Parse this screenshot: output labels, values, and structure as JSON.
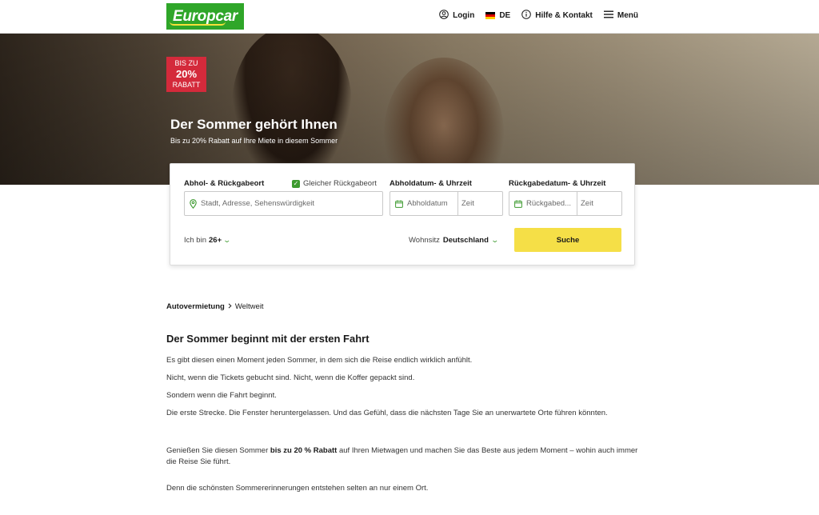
{
  "header": {
    "logo_text": "Europcar",
    "nav": {
      "login": "Login",
      "language": "DE",
      "help": "Hilfe & Kontakt",
      "menu": "Menü"
    }
  },
  "hero": {
    "badge_line1": "BIS ZU",
    "badge_line2": "20%",
    "badge_line3": "RABATT",
    "title": "Der Sommer gehört Ihnen",
    "subtitle": "Bis zu 20% Rabatt auf Ihre Miete in diesem Sommer"
  },
  "booking": {
    "location_label": "Abhol- & Rückgabeort",
    "same_return_label": "Gleicher Rückgabeort",
    "same_return_checked": true,
    "pickup_label": "Abholdatum- & Uhrzeit",
    "return_label": "Rückgabedatum- & Uhrzeit",
    "location_placeholder": "Stadt, Adresse, Sehenswürdigkeit",
    "pickup_date_placeholder": "Abholdatum",
    "pickup_time_placeholder": "Zeit",
    "return_date_placeholder": "Rückgabed...",
    "return_time_placeholder": "Zeit",
    "age_prefix": "Ich bin",
    "age_value": "26+",
    "residence_label": "Wohnsitz",
    "residence_value": "Deutschland",
    "search_button": "Suche"
  },
  "breadcrumb": {
    "item1": "Autovermietung",
    "item2": "Weltweit"
  },
  "content": {
    "title": "Der Sommer beginnt mit der ersten Fahrt",
    "p1": "Es gibt diesen einen Moment jeden Sommer, in dem sich die Reise endlich wirklich anfühlt.",
    "p2": "Nicht, wenn die Tickets gebucht sind. Nicht, wenn die Koffer gepackt sind.",
    "p3": "Sondern wenn die Fahrt beginnt.",
    "p4": "Die erste Strecke. Die Fenster heruntergelassen. Und das Gefühl, dass die nächsten Tage Sie an unerwartete Orte führen könnten.",
    "p5_before": "Genießen Sie diesen Sommer ",
    "p5_bold": "bis zu 20 % Rabatt",
    "p5_after": " auf Ihren Mietwagen und machen Sie das Beste aus jedem Moment – wohin auch immer die Reise Sie führt.",
    "p6": "Denn die schönsten Sommererinnerungen entstehen selten an nur einem Ort."
  },
  "colors": {
    "brand_green": "#2fa629",
    "accent_yellow": "#f5df47",
    "badge_red": "#d42a3b",
    "check_green": "#3d9a2f"
  },
  "icons": [
    "user-icon",
    "germany-flag-icon",
    "info-icon",
    "menu-icon",
    "location-pin-icon",
    "calendar-icon",
    "check-icon",
    "chevron-down-icon",
    "chevron-right-icon"
  ]
}
